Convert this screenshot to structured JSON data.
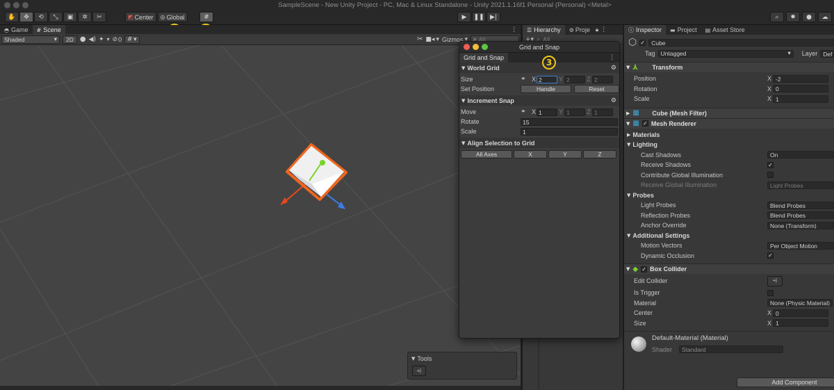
{
  "window": {
    "title": "SampleScene - New Unity Project - PC, Mac & Linux Standalone - Unity 2021.1.16f1 Personal (Personal) <Metal>"
  },
  "toolbar": {
    "pivot_label": "Center",
    "space_label": "Global",
    "callouts": [
      "1",
      "2",
      "3"
    ]
  },
  "tabs": {
    "game": "Game",
    "scene": "Scene",
    "hierarchy": "Hierarchy",
    "project_short": "Proje",
    "inspector": "Inspector",
    "project": "Project",
    "asset_store": "Asset Store"
  },
  "scene_toolbar": {
    "shading_mode": "Shaded",
    "mode_2d": "2D",
    "hidden_count": "0",
    "gizmos_label": "Gizmos",
    "search_placeholder": "All"
  },
  "hierarchy": {
    "search_placeholder": "All"
  },
  "tools_overlay": {
    "title": "Tools"
  },
  "grid_snap": {
    "window_title": "Grid and Snap",
    "tab_label": "Grid and Snap",
    "world_grid": {
      "title": "World Grid",
      "size_label": "Size",
      "size": {
        "x": "2",
        "y": "2",
        "z": "2"
      },
      "set_position_label": "Set Position",
      "handle_button": "Handle",
      "reset_button": "Reset"
    },
    "increment_snap": {
      "title": "Increment Snap",
      "move_label": "Move",
      "move": {
        "x": "1",
        "y": "1",
        "z": "1"
      },
      "rotate_label": "Rotate",
      "rotate_value": "15",
      "scale_label": "Scale",
      "scale_value": "1"
    },
    "align": {
      "title": "Align Selection to Grid",
      "all_axes": "All Axes",
      "x": "X",
      "y": "Y",
      "z": "Z"
    },
    "axis_labels": {
      "x": "X",
      "y": "Y",
      "z": "Z"
    }
  },
  "inspector": {
    "object_name": "Cube",
    "tag_label": "Tag",
    "tag_value": "Untagged",
    "layer_label": "Layer",
    "layer_value": "Def",
    "transform": {
      "title": "Transform",
      "position_label": "Position",
      "position_x": "-2",
      "rotation_label": "Rotation",
      "rotation_x": "0",
      "scale_label": "Scale",
      "scale_x": "1"
    },
    "mesh_filter": {
      "title": "Cube (Mesh Filter)"
    },
    "mesh_renderer": {
      "title": "Mesh Renderer",
      "materials_label": "Materials",
      "lighting_label": "Lighting",
      "cast_shadows_label": "Cast Shadows",
      "cast_shadows_value": "On",
      "receive_shadows_label": "Receive Shadows",
      "contribute_gi_label": "Contribute Global Illumination",
      "receive_gi_label": "Receive Global Illumination",
      "receive_gi_value": "Light Probes",
      "probes_label": "Probes",
      "light_probes_label": "Light Probes",
      "light_probes_value": "Blend Probes",
      "reflection_probes_label": "Reflection Probes",
      "reflection_probes_value": "Blend Probes",
      "anchor_override_label": "Anchor Override",
      "anchor_override_value": "None (Transform)",
      "additional_settings_label": "Additional Settings",
      "motion_vectors_label": "Motion Vectors",
      "motion_vectors_value": "Per Object Motion",
      "dynamic_occlusion_label": "Dynamic Occlusion"
    },
    "box_collider": {
      "title": "Box Collider",
      "edit_collider_label": "Edit Collider",
      "is_trigger_label": "Is Trigger",
      "material_label": "Material",
      "material_value": "None (Physic Material)",
      "center_label": "Center",
      "center_x": "0",
      "size_label": "Size",
      "size_x": "1"
    },
    "material": {
      "name": "Default-Material (Material)",
      "shader_label": "Shader",
      "shader_value": "Standard"
    },
    "add_component_label": "Add Component"
  },
  "colors": {
    "accent_blue": "#3d7fd3",
    "callout_yellow": "#f0c818",
    "selection_orange": "#f0661e",
    "axis_x": "#e8481e",
    "axis_y": "#7ad32a",
    "axis_z": "#3b7ee8"
  }
}
